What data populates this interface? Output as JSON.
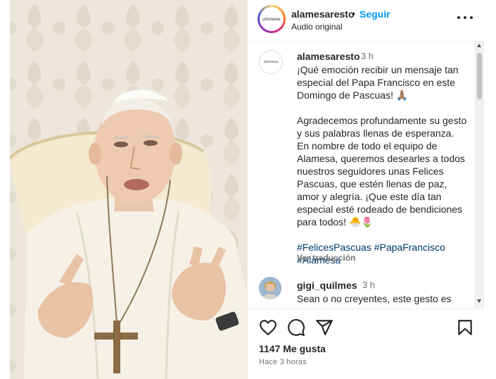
{
  "post": {
    "username": "alamesaresto",
    "separator": "•",
    "follow_label": "Seguir",
    "audio_label": "Audio original",
    "avatar_text": "alamesa"
  },
  "caption": {
    "username": "alamesaresto",
    "time": "3 h",
    "paragraph1": "¡Qué emoción recibir un mensaje tan especial del Papa Francisco en este Domingo de Pascuas! 🙏🏽",
    "paragraph2": "Agradecemos profundamente su gesto y sus palabras llenas de esperanza. En nombre de todo el equipo de Alamesa, queremos desearles a todos nuestros seguidores unas Felices Pascuas, que estén llenas de paz, amor y alegría. ¡Que este día tan especial esté rodeado de bendiciones para todos! 🐣🌷",
    "hashtag1": "#FelicesPascuas",
    "hashtag2": "#PapaFrancisco",
    "hashtag3": "#Alamesa",
    "translate_label": "Ver traducción"
  },
  "comment": {
    "username": "gigi_quilmes",
    "time": "3 h",
    "text": "Sean o no creyentes, este gesto es maravilloso... Todo lo que dice"
  },
  "actions": {
    "likes": "1147 Me gusta",
    "posted_ago": "Hace 3 horas"
  },
  "icons": {
    "like": "heart-icon",
    "comment": "comment-icon",
    "share": "share-icon",
    "save": "bookmark-icon",
    "more": "more-options-icon"
  },
  "colors": {
    "follow": "#0095f6",
    "hashtag": "#00376b",
    "muted": "#737373"
  }
}
